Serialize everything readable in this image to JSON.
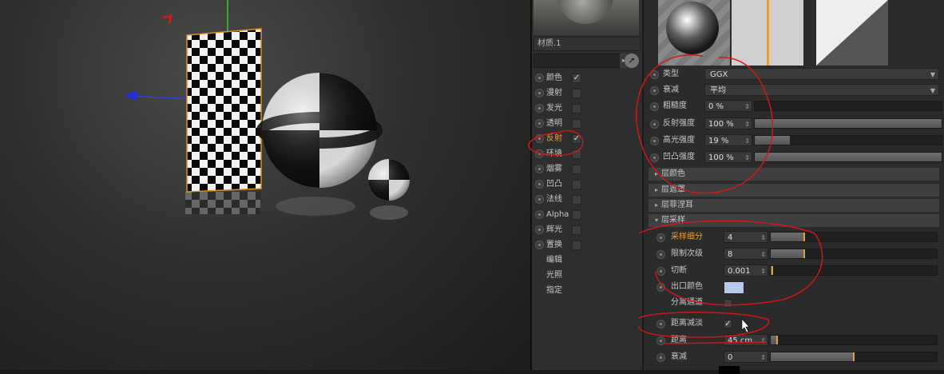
{
  "viewport": {
    "label": "3D viewport"
  },
  "material": {
    "name": "材质.1"
  },
  "channels": [
    {
      "label": "颜色",
      "checked": true,
      "active": false
    },
    {
      "label": "漫射",
      "checked": false,
      "active": false
    },
    {
      "label": "发光",
      "checked": false,
      "active": false
    },
    {
      "label": "透明",
      "checked": false,
      "active": false
    },
    {
      "label": "反射",
      "checked": true,
      "active": true
    },
    {
      "label": "环境",
      "checked": false,
      "active": false
    },
    {
      "label": "烟雾",
      "checked": false,
      "active": false
    },
    {
      "label": "凹凸",
      "checked": false,
      "active": false
    },
    {
      "label": "法线",
      "checked": false,
      "active": false
    },
    {
      "label": "Alpha",
      "checked": false,
      "active": false
    },
    {
      "label": "辉光",
      "checked": false,
      "active": false
    },
    {
      "label": "置换",
      "checked": false,
      "active": false
    }
  ],
  "extra_channels": [
    "编辑",
    "光照",
    "指定"
  ],
  "attributes": {
    "type": {
      "label": "类型",
      "value": "GGX"
    },
    "falloff": {
      "label": "衰减",
      "value": "平均"
    },
    "roughness": {
      "label": "粗糙度",
      "value": "0 %",
      "level": 0.0
    },
    "reflect_strength": {
      "label": "反射强度",
      "value": "100 %",
      "level": 1.0
    },
    "specular_strength": {
      "label": "高光强度",
      "value": "19 %",
      "level": 0.19
    },
    "bump_strength": {
      "label": "凹凸强度",
      "value": "100 %",
      "level": 1.0
    },
    "layer_color": "层颜色",
    "layer_mask": "层遮罩",
    "layer_fresnel": "层菲涅耳",
    "layer_sampling": "层采样",
    "sample_subdiv": {
      "label": "采样细分",
      "value": "4",
      "level": 0.2
    },
    "limit_level": {
      "label": "限制次级",
      "value": "8",
      "level": 0.2
    },
    "cutoff": {
      "label": "切断",
      "value": "0.001",
      "level": 0.01
    },
    "exit_color": {
      "label": "出口颜色",
      "color": "#b8c8ee"
    },
    "separate_pass": {
      "label": "分离通道"
    },
    "distance_dim": {
      "label": "距离减淡",
      "checked": true
    },
    "distance": {
      "label": "距离",
      "value": "45 cm",
      "level": 0.04
    },
    "dim_falloff": {
      "label": "衰减",
      "value": "0",
      "level": 0.5
    }
  },
  "colors": {
    "accent": "#e0a040",
    "annotation": "#d01818"
  }
}
